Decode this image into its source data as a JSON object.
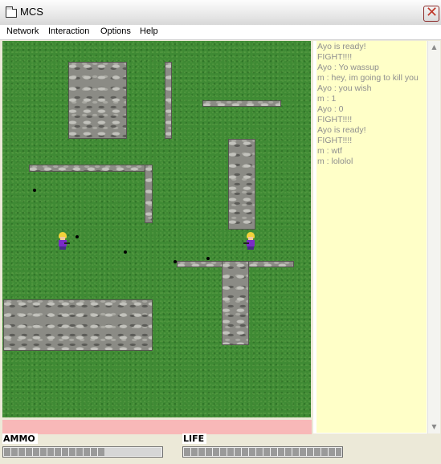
{
  "window": {
    "title": "MCS",
    "icon": "window-icon",
    "close_icon": "close-icon",
    "close_symbol": "✕"
  },
  "menu": {
    "items": [
      "Network",
      "Interaction",
      "Options",
      "Help"
    ]
  },
  "game": {
    "players": [
      "player-left",
      "player-right"
    ],
    "colors": {
      "grass": "#3f8a34",
      "stone": "#8b8b85",
      "hair": "#f2d23a",
      "shirt": "#7a2cc7",
      "bullet": "#000000"
    }
  },
  "chat": {
    "lines": [
      "Ayo is ready!",
      "FIGHT!!!!",
      "Ayo : Yo wassup",
      "m : hey, im going to kill you",
      "Ayo : you wish",
      "m : 1",
      "Ayo : 0",
      "FIGHT!!!!",
      "Ayo is ready!",
      "FIGHT!!!!",
      "m : wtf",
      "m : lololol"
    ],
    "scroll_up": "▲",
    "scroll_down": "▼",
    "colors": {
      "background": "#ffffc8",
      "text": "#8f8f8f"
    }
  },
  "status_bar": {
    "color": "#f8b8b8"
  },
  "hud": {
    "ammo_label": "AMMO",
    "life_label": "LIFE",
    "ammo_fraction": 0.64,
    "life_fraction": 1.0
  }
}
